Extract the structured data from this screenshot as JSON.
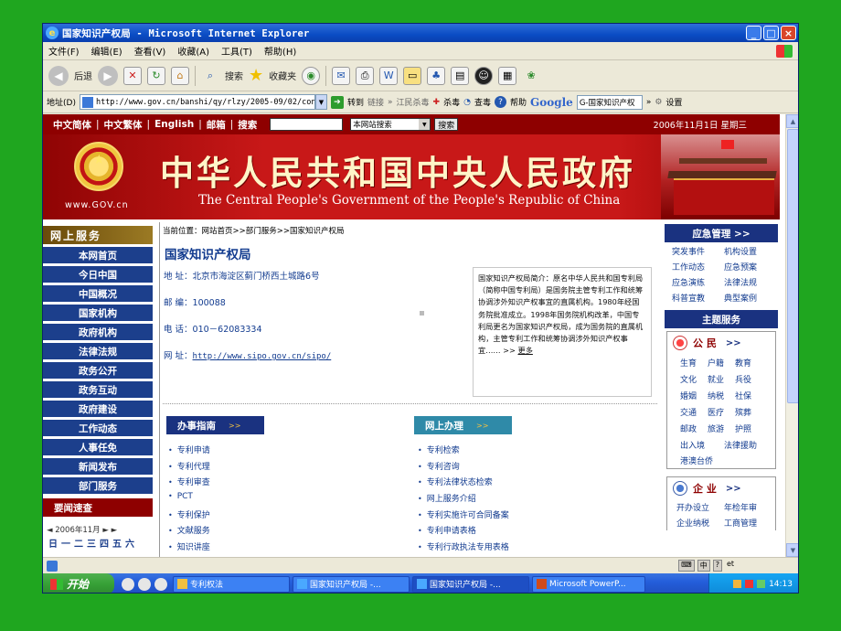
{
  "window": {
    "title": "国家知识产权局 - Microsoft Internet Explorer",
    "controls": [
      "_",
      "□",
      "×"
    ]
  },
  "menubar": [
    "文件(F)",
    "编辑(E)",
    "查看(V)",
    "收藏(A)",
    "工具(T)",
    "帮助(H)"
  ],
  "toolbar": {
    "back": "后退",
    "search": "搜索",
    "favorites": "收藏夹"
  },
  "address": {
    "label": "地址(D)",
    "url": "http://www.gov.cn/banshi/qy/rlzy/2005-09/02/cont",
    "go": "转到",
    "links": "链接",
    "kill1": "江民杀毒",
    "kill2": "杀毒",
    "scan": "查毒",
    "help": "帮助",
    "google": "Google",
    "google_box": "G-国家知识产权",
    "settings": "设置"
  },
  "topnav": {
    "items": [
      "中文简体",
      "中文繁体",
      "English",
      "邮箱",
      "搜索"
    ],
    "select": "本网站搜索",
    "search_button": "搜索",
    "date": "2006年11月1日 星期三"
  },
  "banner": {
    "site": "www.GOV.cn",
    "title_zh": "中华人民共和国中央人民政府",
    "title_en": "The Central People's Government of the People's Republic of China"
  },
  "left": {
    "heading": "网上服务",
    "nav": [
      "本网首页",
      "今日中国",
      "中国概况",
      "国家机构",
      "政府机构",
      "法律法规",
      "政务公开",
      "政务互动",
      "政府建设",
      "工作动态",
      "人事任免",
      "新闻发布",
      "部门服务"
    ],
    "news": "要闻速查",
    "calendar_month": "◄ 2006年11月 ► ►",
    "weekdays": [
      "日",
      "一",
      "二",
      "三",
      "四",
      "五",
      "六"
    ]
  },
  "main": {
    "breadcrumb": "当前位置：网站首页>>部门服务>>国家知识产权局",
    "agency": "国家知识产权局",
    "address_label": "地 址：",
    "address": "北京市海淀区蓟门桥西土城路6号",
    "zip_label": "邮 编：",
    "zip": "100088",
    "phone_label": "电 话：",
    "phone": "010－62083334",
    "web_label": "网 址：",
    "web": "http://www.sipo.gov.cn/sipo/",
    "intro": "国家知识产权局简介：原名中华人民共和国专利局（简称中国专利局）是国务院主管专利工作和统筹协调涉外知识产权事宜的直属机构。1980年经国务院批准成立。1998年国务院机构改革，中国专利局更名为国家知识产权局，成为国务院的直属机构，主管专利工作和统筹协调涉外知识产权事宜…… >>",
    "intro_more": "更多",
    "guide_heading": "办事指南",
    "online_heading": "网上办理",
    "guide_links": [
      "专利申请",
      "专利代理",
      "专利审查",
      "PCT",
      "专利保护",
      "文献服务",
      "知识讲座"
    ],
    "online_links": [
      "专利检索",
      "专利咨询",
      "专利法律状态检索",
      "网上服务介绍",
      "专利实施许可合同备案",
      "专利申请表格",
      "专利行政执法专用表格"
    ],
    "arrow": ">>"
  },
  "right": {
    "emergency": "应急管理  >>",
    "emergency_items": [
      "突发事件",
      "机构设置",
      "工作动态",
      "应急预案",
      "应急演练",
      "法律法规",
      "科普宣教",
      "典型案例"
    ],
    "topic": "主题服务",
    "citizen": "公 民",
    "citizen_items": [
      "生育",
      "户籍",
      "教育",
      "文化",
      "就业",
      "兵役",
      "婚姻",
      "纳税",
      "社保",
      "交通",
      "医疗",
      "殡葬",
      "邮政",
      "旅游",
      "护照"
    ],
    "citizen_extra": [
      "出入境",
      "法律援助",
      "港澳台侨"
    ],
    "enterprise": "企 业",
    "enterprise_items": [
      "开办设立",
      "年检年审",
      "企业纳税",
      "工商管理"
    ],
    "arrow": ">>"
  },
  "statusbar": {
    "lang": [
      "中",
      "?"
    ],
    "tray_text": "et"
  },
  "taskbar": {
    "start": "开始",
    "tasks": [
      "专利权法",
      "国家知识产权局 -...",
      "国家知识产权局 -...",
      "Microsoft PowerP..."
    ],
    "time": "14:13"
  }
}
